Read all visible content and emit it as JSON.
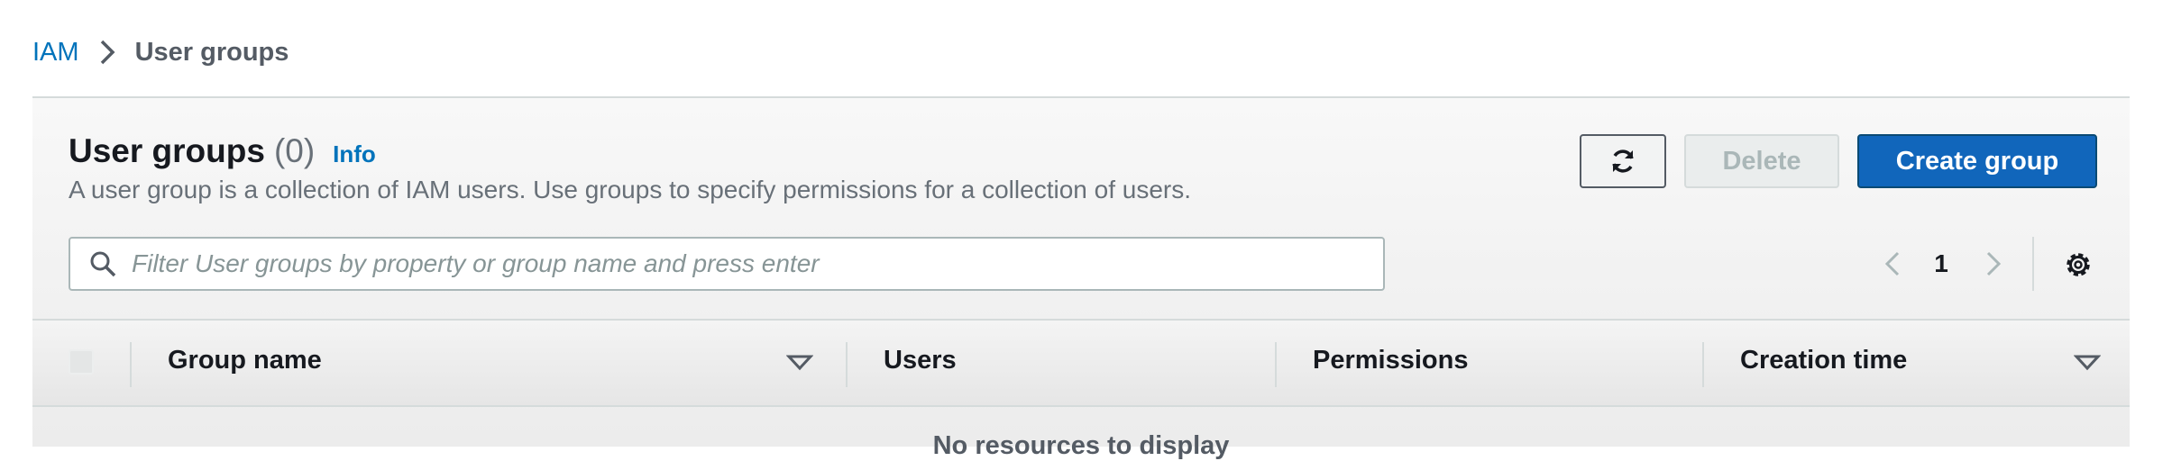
{
  "breadcrumb": {
    "root": "IAM",
    "current": "User groups"
  },
  "header": {
    "title": "User groups",
    "count": "(0)",
    "info_link": "Info",
    "description": "A user group is a collection of IAM users. Use groups to specify permissions for a collection of users."
  },
  "actions": {
    "refresh_icon": "refresh-icon",
    "delete_label": "Delete",
    "create_label": "Create group"
  },
  "filter": {
    "placeholder": "Filter User groups by property or group name and press enter",
    "value": ""
  },
  "pagination": {
    "current_page": "1"
  },
  "table": {
    "columns": [
      "Group name",
      "Users",
      "Permissions",
      "Creation time"
    ],
    "rows": [],
    "empty_message": "No resources to display"
  },
  "colors": {
    "link": "#0073bb",
    "primary_button": "#1166bb",
    "disabled_text": "#aab7b8"
  }
}
